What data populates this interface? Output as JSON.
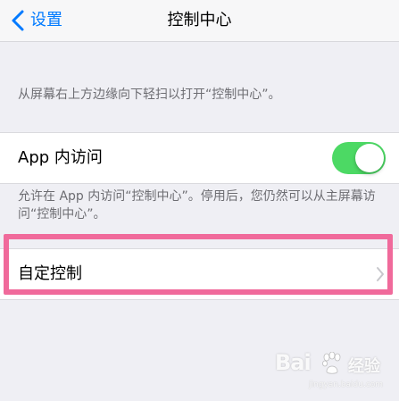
{
  "nav": {
    "back_label": "设置",
    "title": "控制中心"
  },
  "description_top": "从屏幕右上方边缘向下轻扫以打开“控制中心”。",
  "access_row": {
    "label": "App 内访问",
    "toggle_on": true
  },
  "description_access": "允许在 App 内访问“控制中心”。停用后，您仍然可以从主屏幕访问“控制中心”。",
  "custom_row": {
    "label": "自定控制"
  },
  "watermark": {
    "logo": "Bai",
    "suffix": "经验",
    "url": "jingyan.baidu.com"
  },
  "colors": {
    "accent": "#007aff",
    "toggle_on": "#4cd964",
    "highlight": "#f06a9b",
    "background": "#efeff4"
  },
  "icons": [
    "back-chevron-icon",
    "disclosure-chevron-icon",
    "baidu-paw-icon"
  ]
}
